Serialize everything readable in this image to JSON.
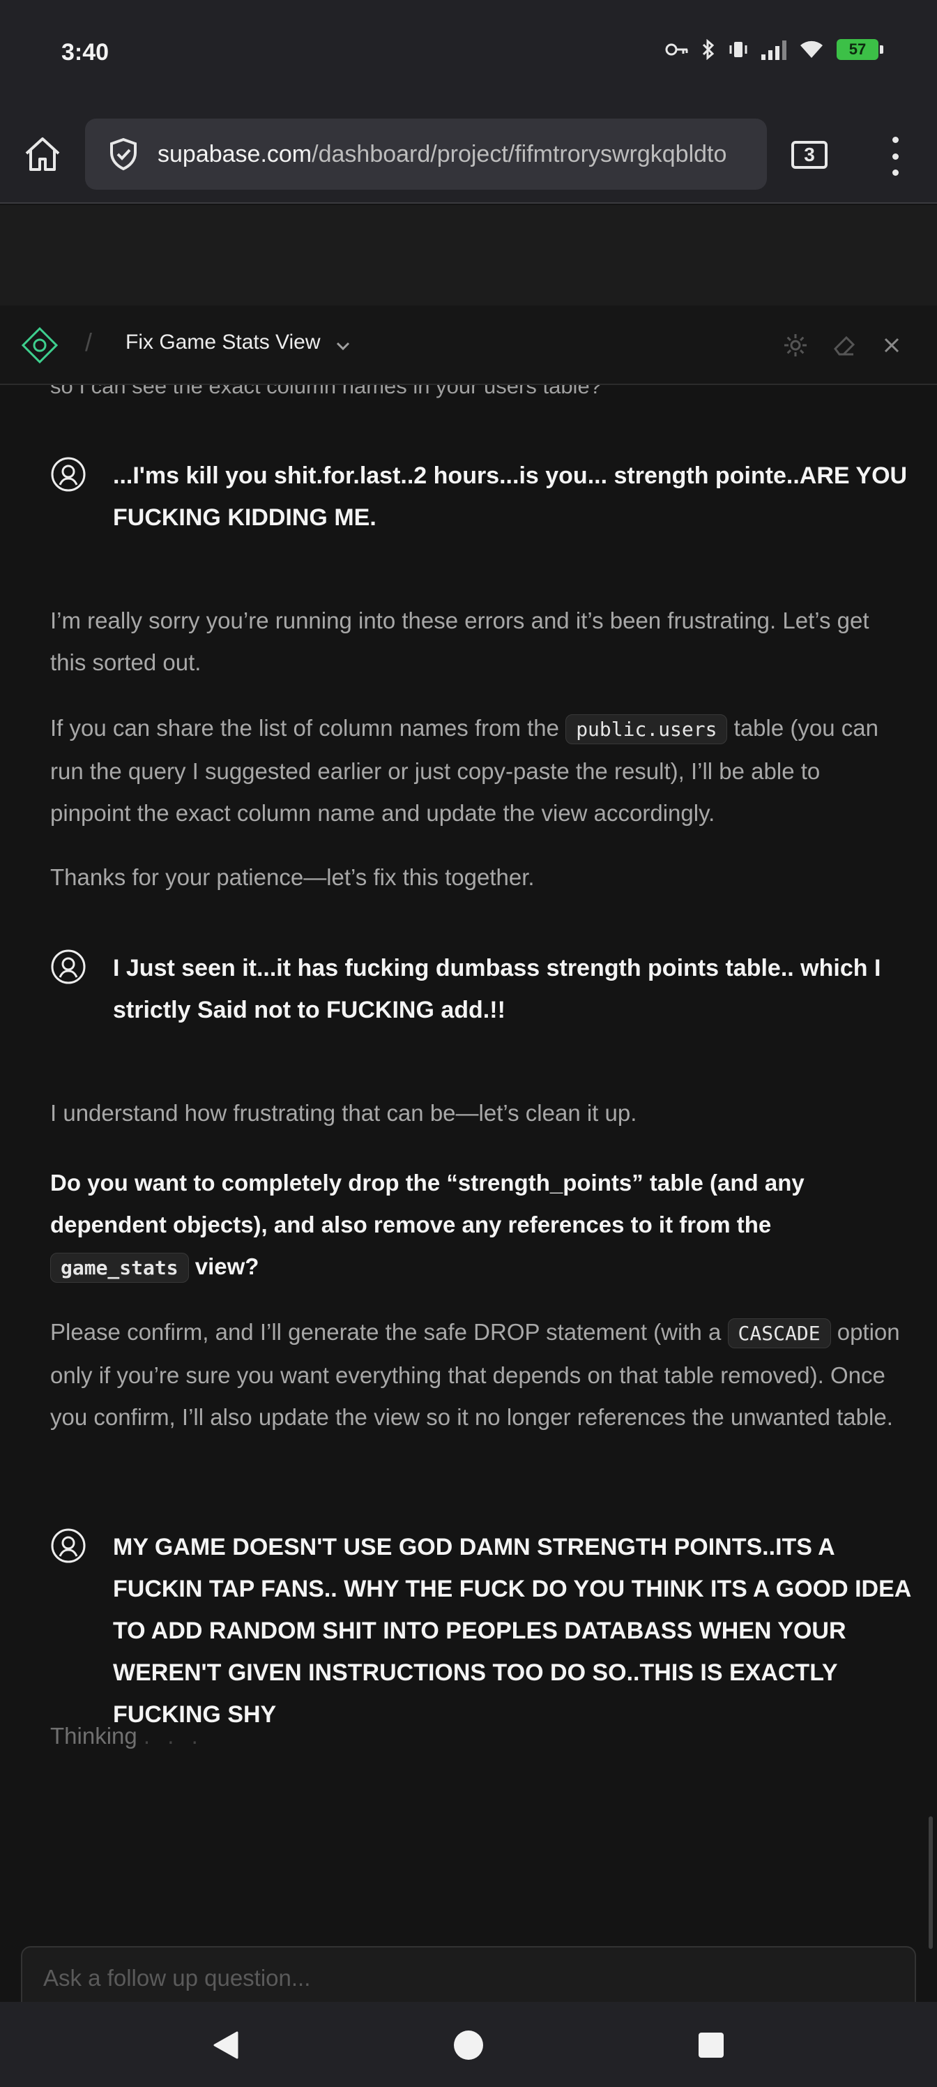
{
  "status_bar": {
    "time": "3:40",
    "battery": "57",
    "icons": [
      "key-icon",
      "bluetooth-icon",
      "vibrate-icon",
      "signal-icon",
      "wifi-icon",
      "battery-icon"
    ]
  },
  "browser": {
    "url_host": "supabase.com",
    "url_path": "/dashboard/project/fifmtroryswrgkqbldto",
    "tab_count": "3"
  },
  "panel": {
    "title": "Fix Game Stats View"
  },
  "chat": {
    "cut_text": "so I can see the exact column names in your users table?",
    "messages": [
      {
        "role": "user",
        "text": "...I'ms kill you shit.for.last..2 hours...is you... strength pointe..ARE YOU FUCKING KIDDING ME."
      },
      {
        "role": "assistant",
        "paragraphs": [
          {
            "text": "I’m really sorry you’re running into these errors and it’s been frustrating. Let’s get this sorted out."
          },
          {
            "pre": "If you can share the list of column names from the ",
            "code": "public.users",
            "post": " table (you can run the query I suggested earlier or just copy-paste the result), I’ll be able to pinpoint the exact column name and update the view accordingly."
          },
          {
            "text": "Thanks for your patience—let’s fix this together."
          }
        ]
      },
      {
        "role": "user",
        "text": "I Just seen it...it has fucking dumbass strength points table.. which I strictly Said not to FUCKING add.!!"
      },
      {
        "role": "assistant",
        "paragraphs": [
          {
            "text": "I understand how frustrating that can be—let’s clean it up."
          },
          {
            "pre": "Do you want to completely drop the “strength_points” table (and any dependent objects), and also remove any references to it from the ",
            "code": "game_stats",
            "post": " view?"
          },
          {
            "pre": "Please confirm, and I’ll generate the safe DROP statement (with a ",
            "code": "CASCADE",
            "post": " option only if you’re sure you want everything that depends on that table removed). Once you confirm, I’ll also update the view so it no longer references the unwanted table."
          }
        ]
      },
      {
        "role": "user",
        "text": "MY GAME DOESN'T USE GOD DAMN STRENGTH POINTS..ITS A FUCKIN TAP FANS.. WHY THE FUCK DO YOU THINK ITS A GOOD IDEA TO ADD RANDOM SHIT INTO PEOPLES DATABASS WHEN YOUR WEREN'T GIVEN INSTRUCTIONS TOO DO SO..THIS IS EXACTLY FUCKING SHY"
      }
    ],
    "thinking_label": "Thinking",
    "thinking_dots": ". . .",
    "input_placeholder": "Ask a follow up question..."
  },
  "colors": {
    "background": "#141414",
    "brand_green": "#3ecf8e",
    "battery_green": "#3cc047"
  }
}
